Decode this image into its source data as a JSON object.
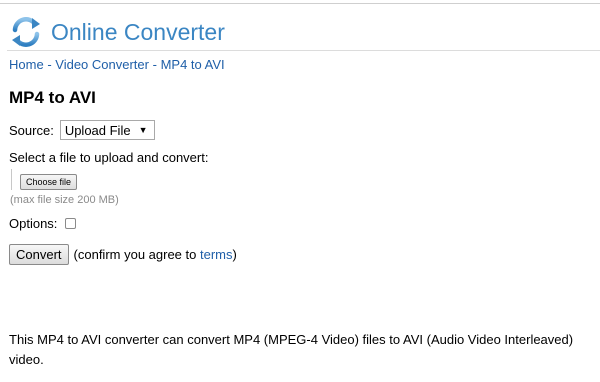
{
  "header": {
    "site_title": "Online Converter",
    "logo_icon": "refresh-arrows-icon"
  },
  "breadcrumb": {
    "items": [
      "Home",
      "Video Converter",
      "MP4 to AVI"
    ],
    "separator": "-"
  },
  "main": {
    "title": "MP4 to AVI",
    "source_label": "Source:",
    "source_selected": "Upload File",
    "select_prompt": "Select a file to upload and convert:",
    "choose_file_label": "Choose file",
    "max_size_note": "(max file size 200 MB)",
    "options_label": "Options:",
    "options_checked": false,
    "convert_label": "Convert",
    "confirm_prefix": "(confirm you agree to",
    "terms_label": "terms",
    "confirm_suffix": ")"
  },
  "description": "This MP4 to AVI converter can convert MP4 (MPEG-4 Video) files to AVI (Audio Video Interleaved) video.",
  "colors": {
    "brand": "#3b86c3",
    "link": "#1f5fa8",
    "muted": "#8a8a8a"
  }
}
